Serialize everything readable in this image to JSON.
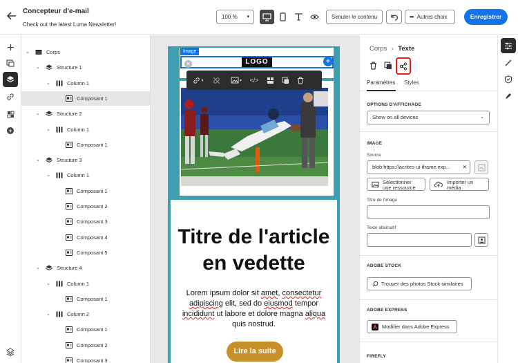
{
  "header": {
    "title": "Concepteur d'e-mail",
    "subtitle": "Check out the latest Luma Newsletter!",
    "zoom": "100 %",
    "simulate_label": "Simuler le contenu",
    "more_label": "Autres choix",
    "save_label": "Enregistrer"
  },
  "tree": {
    "items": [
      {
        "label": "Corps",
        "level": 0,
        "type": "body"
      },
      {
        "label": "Structure 1",
        "level": 1,
        "type": "structure"
      },
      {
        "label": "Column 1",
        "level": 2,
        "type": "column"
      },
      {
        "label": "Composant 1",
        "level": 3,
        "type": "component",
        "selected": true
      },
      {
        "label": "Structure 2",
        "level": 1,
        "type": "structure"
      },
      {
        "label": "Column 1",
        "level": 2,
        "type": "column"
      },
      {
        "label": "Composant 1",
        "level": 3,
        "type": "component"
      },
      {
        "label": "Structure 3",
        "level": 1,
        "type": "structure"
      },
      {
        "label": "Column 1",
        "level": 2,
        "type": "column"
      },
      {
        "label": "Composant 1",
        "level": 3,
        "type": "component"
      },
      {
        "label": "Composant 2",
        "level": 3,
        "type": "component"
      },
      {
        "label": "Composant 3",
        "level": 3,
        "type": "component"
      },
      {
        "label": "Composant 4",
        "level": 3,
        "type": "component"
      },
      {
        "label": "Composant 5",
        "level": 3,
        "type": "component"
      },
      {
        "label": "Structure 4",
        "level": 1,
        "type": "structure"
      },
      {
        "label": "Column 1",
        "level": 2,
        "type": "column"
      },
      {
        "label": "Composant 1",
        "level": 3,
        "type": "component"
      },
      {
        "label": "Column 2",
        "level": 2,
        "type": "column"
      },
      {
        "label": "Composant 1",
        "level": 3,
        "type": "component"
      },
      {
        "label": "Composant 2",
        "level": 3,
        "type": "component"
      },
      {
        "label": "Composant 3",
        "level": 3,
        "type": "component"
      }
    ]
  },
  "canvas": {
    "image_tag": "Image",
    "logo_text": "LOGO",
    "article_title": "Titre de l'article en vedette",
    "article_body_parts": [
      "Lorem ipsum dolor sit ",
      "amet",
      ", ",
      "consectetur adipiscing",
      " elit, sed do ",
      "eiusmod",
      " tempor ",
      "incididunt",
      " ut labore et dolore magna ",
      "aliqua",
      " quis nostrud."
    ],
    "cta": "Lire la suite"
  },
  "panel": {
    "breadcrumb_parent": "Corps",
    "breadcrumb_current": "Texte",
    "tab_params": "Paramètres",
    "tab_styles": "Styles",
    "display_section": "OPTIONS D'AFFICHAGE",
    "display_value": "Show on all devices",
    "image_section": "IMAGE",
    "source_label": "Source",
    "source_value": "blob:https://acrites-ui-iframe.exp...",
    "select_resource_1": "Sélectionner",
    "select_resource_2": "une ressource",
    "import_media_1": "Importer un",
    "import_media_2": "média",
    "image_title_label": "Titre de l'image",
    "alt_text_label": "Texte alternatif",
    "stock_section": "ADOBE STOCK",
    "stock_button": "Trouver des photos Stock similaires",
    "express_section": "ADOBE EXPRESS",
    "express_button": "Modifier dans Adobe Express",
    "firefly_section": "FIREFLY"
  },
  "colors": {
    "accent": "#1473e6",
    "email_border": "#3d9fb0",
    "cta": "#c8902a",
    "highlight": "#e41b1b"
  }
}
